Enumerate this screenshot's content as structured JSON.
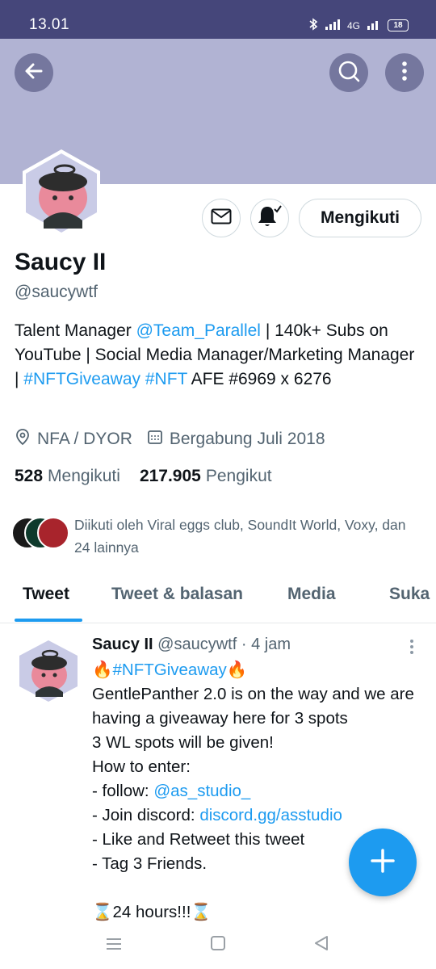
{
  "status_bar": {
    "time": "13.01",
    "network": "4G",
    "battery": "18"
  },
  "header": {
    "back_icon": "arrow-left-icon",
    "search_icon": "search-icon",
    "more_icon": "more-vertical-icon"
  },
  "profile": {
    "name": "Saucy II",
    "handle": "@saucywtf",
    "follow_label": "Mengikuti",
    "bio": {
      "p1": "Talent Manager ",
      "mention": "@Team_Parallel",
      "p2": " | 140k+ Subs on YouTube | Social Media Manager/Marketing Manager | ",
      "tag1": "#NFTGiveaway",
      "space": " ",
      "tag2": "#NFT",
      "p3": " AFE #6969 x 6276"
    },
    "location": "NFA / DYOR",
    "joined": "Bergabung Juli 2018",
    "following_count": "528",
    "following_label": "Mengikuti",
    "followers_count": "217.905",
    "followers_label": "Pengikut",
    "followed_by": "Diikuti oleh Viral eggs club, SoundIt World, Voxy, dan 24 lainnya"
  },
  "tabs": [
    {
      "label": "Tweet",
      "active": true
    },
    {
      "label": "Tweet & balasan",
      "active": false
    },
    {
      "label": "Media",
      "active": false
    },
    {
      "label": "Suka",
      "active": false
    }
  ],
  "tweet": {
    "name": "Saucy II",
    "handle": "@saucywtf",
    "separator": "·",
    "time": "4 jam",
    "hashtag_line_prefix": "🔥",
    "hashtag": "#NFTGiveaway",
    "hashtag_line_suffix": "🔥",
    "line1": "GentlePanther 2.0 is on the way and we are having a giveaway here for 3 spots",
    "line2": "3 WL spots will be given!",
    "line3": "How to enter:",
    "line4_prefix": "- follow: ",
    "line4_link": "@as_studio_",
    "line5_prefix": "- Join discord: ",
    "line5_link": "discord.gg/asstudio",
    "line6": "- Like and Retweet this tweet",
    "line7": "- Tag 3 Friends.",
    "line8": "⌛24 hours!!!⌛"
  },
  "colors": {
    "accent": "#1d9bf0",
    "banner": "#b1b3d3",
    "status_bar": "#45467a"
  }
}
